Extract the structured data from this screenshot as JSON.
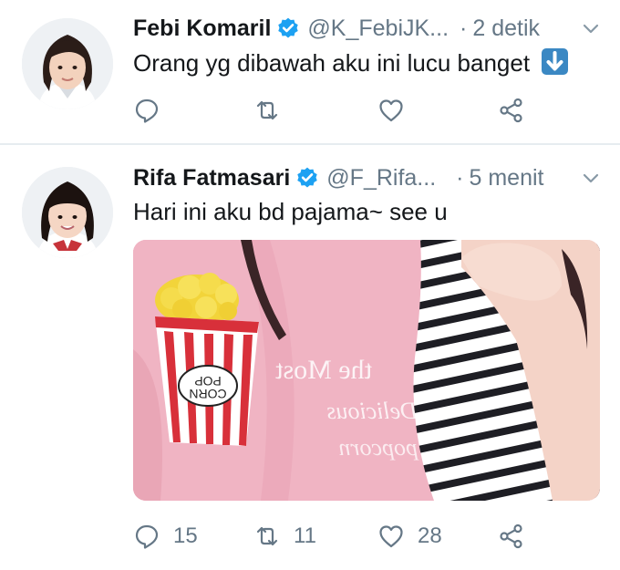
{
  "tweets": [
    {
      "name": "Febi Komaril",
      "handle": "@K_FebiJK...",
      "separator": "·",
      "time": "2 detik",
      "text": "Orang yg dibawah aku ini lucu banget",
      "emoji": "down-arrow-emoji",
      "counts": {
        "reply": "",
        "retweet": "",
        "like": ""
      }
    },
    {
      "name": "Rifa Fatmasari",
      "handle": "@F_Rifa...",
      "separator": "·",
      "time": "5 menit",
      "text": "Hari ini aku bd pajama~ see u",
      "media": {
        "sticker_text_top": "POP",
        "sticker_text_bottom": "CORN",
        "shirt_text_1": "the Most",
        "shirt_text_2": "Delicious",
        "shirt_text_3": "popcorn"
      },
      "counts": {
        "reply": "15",
        "retweet": "11",
        "like": "28"
      }
    }
  ],
  "colors": {
    "verified": "#1da1f2",
    "icon": "#657786",
    "divider": "#e6ecf0",
    "emoji_bg": "#3b88c3",
    "shirt_pink": "#f2b8c6"
  },
  "icons": [
    "verified-icon",
    "chevron-down-icon",
    "reply-icon",
    "retweet-icon",
    "like-icon",
    "share-icon"
  ]
}
